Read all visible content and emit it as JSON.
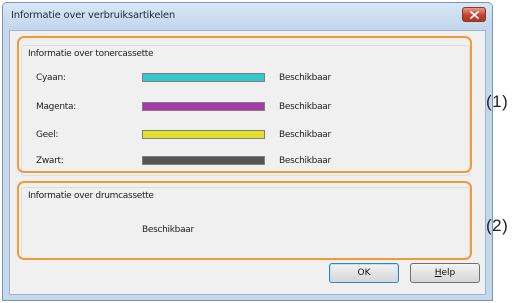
{
  "window": {
    "title": "Informatie over verbruiksartikelen"
  },
  "toner": {
    "group_title": "Informatie over tonercassette",
    "rows": [
      {
        "label": "Cyaan:",
        "status": "Beschikbaar",
        "color": "#36c8c8",
        "level": 1.0
      },
      {
        "label": "Magenta:",
        "status": "Beschikbaar",
        "color": "#a63ba8",
        "level": 1.0
      },
      {
        "label": "Geel:",
        "status": "Beschikbaar",
        "color": "#e2e02c",
        "level": 1.0
      },
      {
        "label": "Zwart:",
        "status": "Beschikbaar",
        "color": "#555555",
        "level": 1.0
      }
    ]
  },
  "drum": {
    "group_title": "Informatie over drumcassette",
    "status": "Beschikbaar"
  },
  "buttons": {
    "ok": "OK",
    "help_first": "H",
    "help_rest": "elp"
  },
  "callouts": {
    "one": "(1)",
    "two": "(2)"
  },
  "colors": {
    "highlight": "#f09a3a",
    "accent": "#3c7fb1"
  }
}
